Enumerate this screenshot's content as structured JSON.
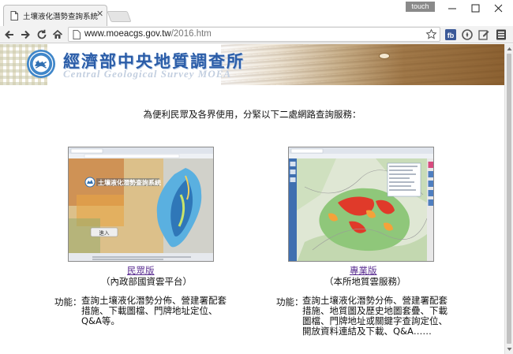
{
  "browser": {
    "tab_title": "土壤液化潛勢查詢系統",
    "touch_label": "touch",
    "url_host": "www.moeacgs.gov.tw",
    "url_path": "/2016.htm"
  },
  "icons": {
    "tab": "page-icon",
    "tab_close": "close-icon",
    "back": "arrow-left-icon",
    "forward": "arrow-right-icon",
    "reload": "reload-icon",
    "home": "home-icon",
    "bookmark": "star-icon",
    "extensions": [
      "facebook-icon",
      "compass-icon",
      "edit-icon",
      "menu-icon"
    ]
  },
  "header": {
    "org_name": "經濟部中央地質調查所",
    "org_name_en": "Central Geological Survey  MOEA"
  },
  "main": {
    "intro": "為便利民眾及各界使用，分緊以下二處網路查詢服務：",
    "services": [
      {
        "link_label": "民眾版",
        "provider": "（內政部國資雲平台）",
        "function_label": "功能：",
        "function_lines": [
          "查詢土壤液化潛勢分佈、營建署配套",
          "措施、下載圖檔、門牌地址定位、",
          "Q&A等。"
        ],
        "screenshot_text": "土壤液化潛勢查詢系統",
        "screenshot_button": "進入"
      },
      {
        "link_label": "專業版",
        "provider": "（本所地質雲服務）",
        "function_label": "功能：",
        "function_lines": [
          "查詢土壤液化潛勢分佈、營建署配套",
          "措施、地質圖及歷史地圖套疊、下載",
          "圖檔、門牌地址或關鍵字查詢定位、",
          "開放資料連結及下載、Q&A……"
        ]
      }
    ]
  },
  "colors": {
    "link": "#5a2d91",
    "title_blue": "#2b5da8",
    "map_green": "#8fc77a",
    "map_red": "#e03a2a"
  }
}
